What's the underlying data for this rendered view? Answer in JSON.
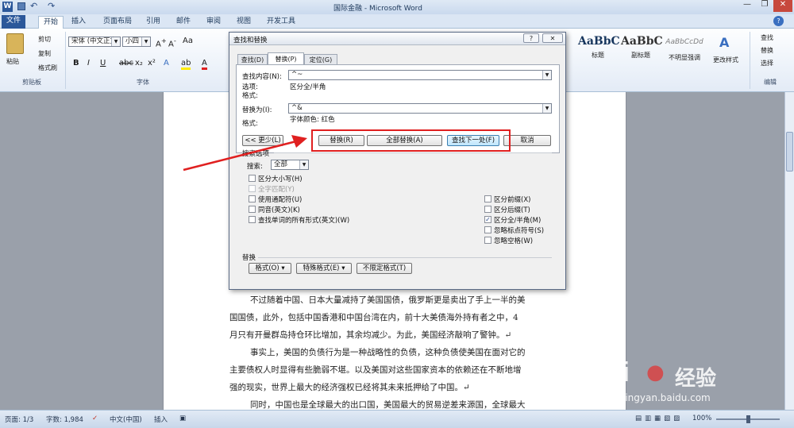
{
  "window": {
    "title": "国际金融 - Microsoft Word"
  },
  "ribbon_tabs": [
    "文件",
    "开始",
    "插入",
    "页面布局",
    "引用",
    "邮件",
    "审阅",
    "视图",
    "开发工具"
  ],
  "clipboard": {
    "paste": "粘贴",
    "cut": "剪切",
    "copy": "复制",
    "format_painter": "格式刷",
    "group": "剪贴板"
  },
  "font": {
    "name": "宋体 (中文正文)",
    "size": "小四",
    "group": "字体"
  },
  "styles": {
    "items": [
      {
        "preview": "AaBbC",
        "label": "标题"
      },
      {
        "preview": "AaBbC",
        "label": "副标题"
      },
      {
        "preview": "AaBbCcDd",
        "label": "不明显强调"
      }
    ],
    "change": "更改样式"
  },
  "editing": {
    "find": "查找",
    "replace": "替换",
    "select": "选择",
    "group": "编辑"
  },
  "dialog": {
    "title": "查找和替换",
    "tabs": [
      "查找(D)",
      "替换(P)",
      "定位(G)"
    ],
    "find_label": "查找内容(N):",
    "find_value": "^~",
    "options_label": "选项:",
    "options_value": "区分全/半角",
    "format_label": "格式:",
    "replace_label": "替换为(I):",
    "replace_value": "^&",
    "replace_format_label": "格式:",
    "replace_format_value": "字体颜色: 红色",
    "less_button": "<< 更少(L)",
    "replace_button": "替换(R)",
    "replace_all_button": "全部替换(A)",
    "find_next_button": "查找下一处(F)",
    "cancel_button": "取消",
    "search_options_title": "搜索选项",
    "search_label": "搜索:",
    "search_value": "全部",
    "left_options": [
      {
        "label": "区分大小写(H)",
        "checked": false,
        "disabled": false
      },
      {
        "label": "全字匹配(Y)",
        "checked": false,
        "disabled": true
      },
      {
        "label": "使用通配符(U)",
        "checked": false,
        "disabled": false
      },
      {
        "label": "同音(英文)(K)",
        "checked": false,
        "disabled": false
      },
      {
        "label": "查找单词的所有形式(英文)(W)",
        "checked": false,
        "disabled": false
      }
    ],
    "right_options": [
      {
        "label": "区分前缀(X)",
        "checked": false
      },
      {
        "label": "区分后缀(T)",
        "checked": false
      },
      {
        "label": "区分全/半角(M)",
        "checked": true
      },
      {
        "label": "忽略标点符号(S)",
        "checked": false
      },
      {
        "label": "忽略空格(W)",
        "checked": false
      }
    ],
    "replace_section": "替换",
    "format_button": "格式(O) ▾",
    "special_button": "特殊格式(E) ▾",
    "noformat_button": "不限定格式(T)"
  },
  "document": {
    "lines": [
      "不过随着中国、日本大量减持了美国国债，俄罗斯更是卖出了手上一半的美",
      "国国债，此外，包括中国香港和中国台湾在内，前十大美债海外持有者之中，4",
      "月只有开曼群岛持仓环比增加，其余均减少。为此，美国经济敲响了警钟。↵",
      "事实上，美国的负债行为是一种战略性的负债，这种负债使美国在面对它的",
      "主要债权人时显得有些脆弱不堪。以及美国对这些国家资本的依赖还在不断地增",
      "强的现实，世界上最大的经济强权已经将其未来抵押给了中国。↵",
      "同时，中国也是全球最大的出口国，美国最大的贸易逆差来源国，全球最大"
    ]
  },
  "status": {
    "page": "页面: 1/3",
    "words": "字数: 1,984",
    "lang": "中文(中国)",
    "insert": "插入",
    "zoom": "100%"
  },
  "watermark": {
    "brand": "Bai",
    "brand2": "经验",
    "url": "jingyan.baidu.com"
  },
  "colors": {
    "highlight_box": "#e02020",
    "arrow": "#e02020",
    "file_tab": "#2b579a"
  }
}
